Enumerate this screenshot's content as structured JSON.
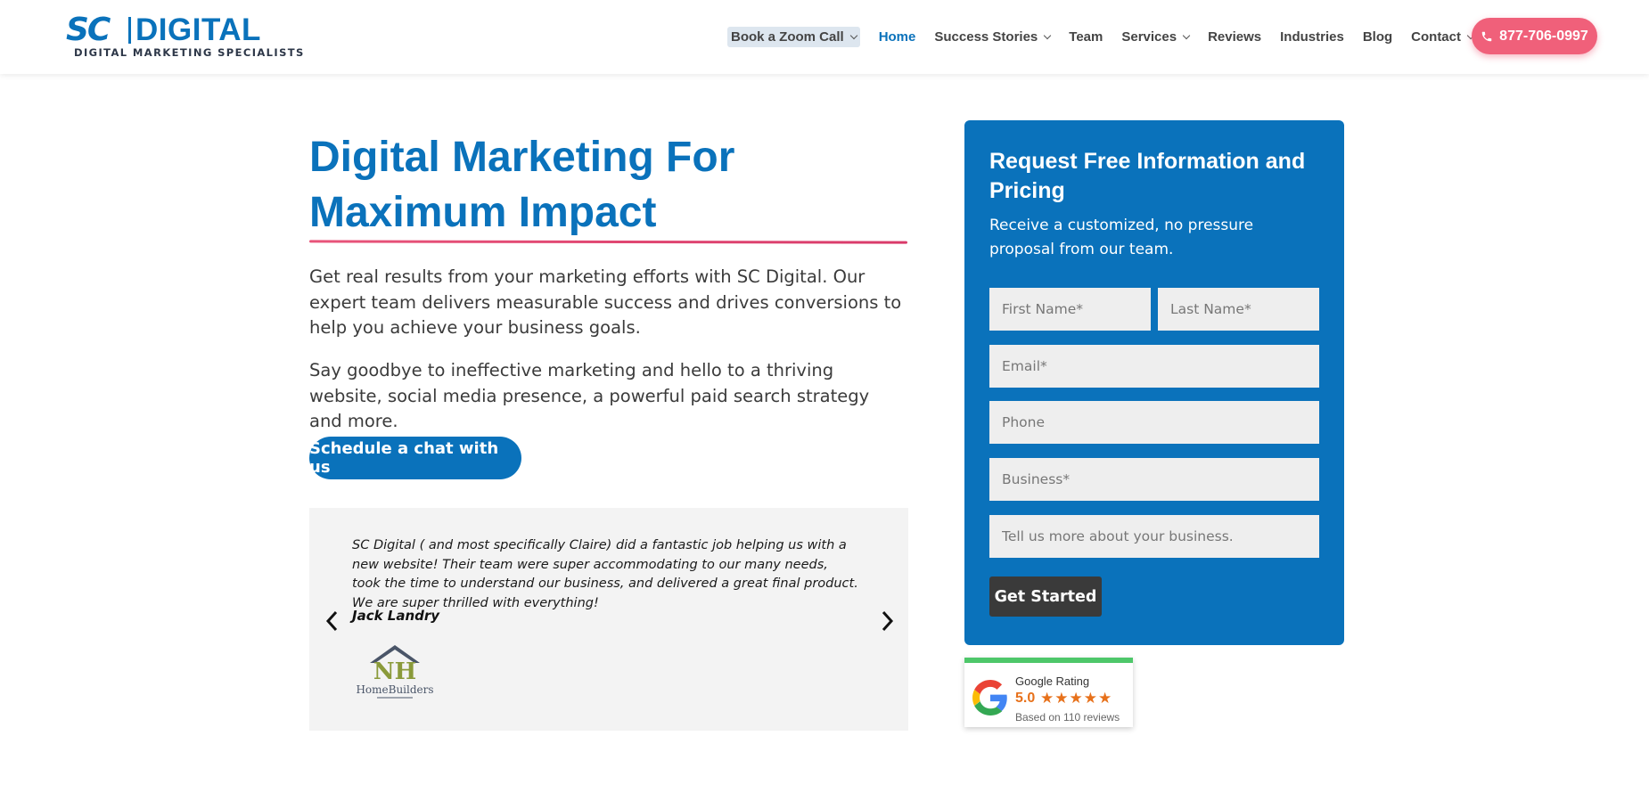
{
  "brand": {
    "logo_sc": "SC",
    "logo_digital": "DIGITAL",
    "tagline": "DIGITAL MARKETING SPECIALISTS"
  },
  "nav": {
    "items": [
      {
        "label": "Book a Zoom Call",
        "dropdown": true
      },
      {
        "label": "Home",
        "active": true
      },
      {
        "label": "Success Stories",
        "dropdown": true
      },
      {
        "label": "Team"
      },
      {
        "label": "Services",
        "dropdown": true
      },
      {
        "label": "Reviews"
      },
      {
        "label": "Industries"
      },
      {
        "label": "Blog"
      },
      {
        "label": "Contact",
        "dropdown": true
      }
    ],
    "phone": "877-706-0997"
  },
  "hero": {
    "title_line1": "Digital Marketing For",
    "title_line2": "Maximum Impact",
    "paragraph1": "Get real results from your marketing efforts with SC Digital. Our expert team delivers measurable success and drives conversions to help you achieve your business goals.",
    "paragraph2": "Say goodbye to ineffective marketing and hello to a thriving website, social media presence, a powerful paid search strategy and more.",
    "cta_label": "Schedule a chat with us"
  },
  "testimonial": {
    "quote": "SC Digital ( and most specifically Claire) did a fantastic job helping us with a new website! Their team were super accommodating to our many needs, took the time to understand our business, and delivered a great final product. We are super thrilled with everything!",
    "author": "Jack Landry",
    "logo_initials": "NH",
    "logo_text": "HomeBuilders"
  },
  "form": {
    "title": "Request Free Information and Pricing",
    "subtitle": "Receive a customized, no pressure proposal from our team.",
    "first_name_placeholder": "First Name*",
    "last_name_placeholder": "Last Name*",
    "email_placeholder": "Email*",
    "phone_placeholder": "Phone",
    "business_placeholder": "Business*",
    "more_placeholder": "Tell us more about your business.",
    "submit_label": "Get Started"
  },
  "google_rating": {
    "label": "Google Rating",
    "score": "5.0",
    "stars": "★★★★★",
    "reviews_text": "Based on 110 reviews"
  },
  "colors": {
    "brand_blue": "#0a72bb",
    "accent_pink": "#f0607a",
    "star_orange": "#e7711b",
    "rating_green": "#4ec76a"
  }
}
